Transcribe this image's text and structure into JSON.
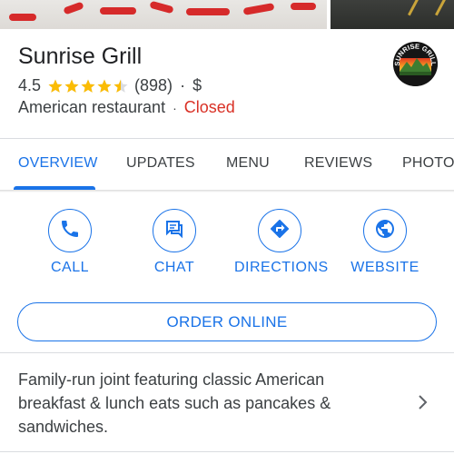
{
  "place": {
    "name": "Sunrise Grill",
    "rating": "4.5",
    "rating_value": 4.5,
    "rating_max": 5,
    "review_count": "(898)",
    "price": "$",
    "category": "American restaurant",
    "status": "Closed",
    "logo_text": "SUNRISE GRILL"
  },
  "tabs": [
    {
      "label": "OVERVIEW",
      "active": true
    },
    {
      "label": "UPDATES",
      "active": false
    },
    {
      "label": "MENU",
      "active": false
    },
    {
      "label": "REVIEWS",
      "active": false
    },
    {
      "label": "PHOTOS",
      "active": false
    }
  ],
  "actions": [
    {
      "label": "CALL",
      "icon": "phone-icon"
    },
    {
      "label": "CHAT",
      "icon": "chat-icon"
    },
    {
      "label": "DIRECTIONS",
      "icon": "directions-icon"
    },
    {
      "label": "WEBSITE",
      "icon": "globe-icon"
    }
  ],
  "order_online": "ORDER ONLINE",
  "description": "Family-run joint featuring classic American breakfast & lunch eats such as pancakes & sandwiches.",
  "colors": {
    "accent": "#1a73e8",
    "star": "#fbbc04",
    "closed": "#d93025",
    "text": "#202124",
    "secondary_text": "#3c4043",
    "divider": "#dadce0"
  }
}
